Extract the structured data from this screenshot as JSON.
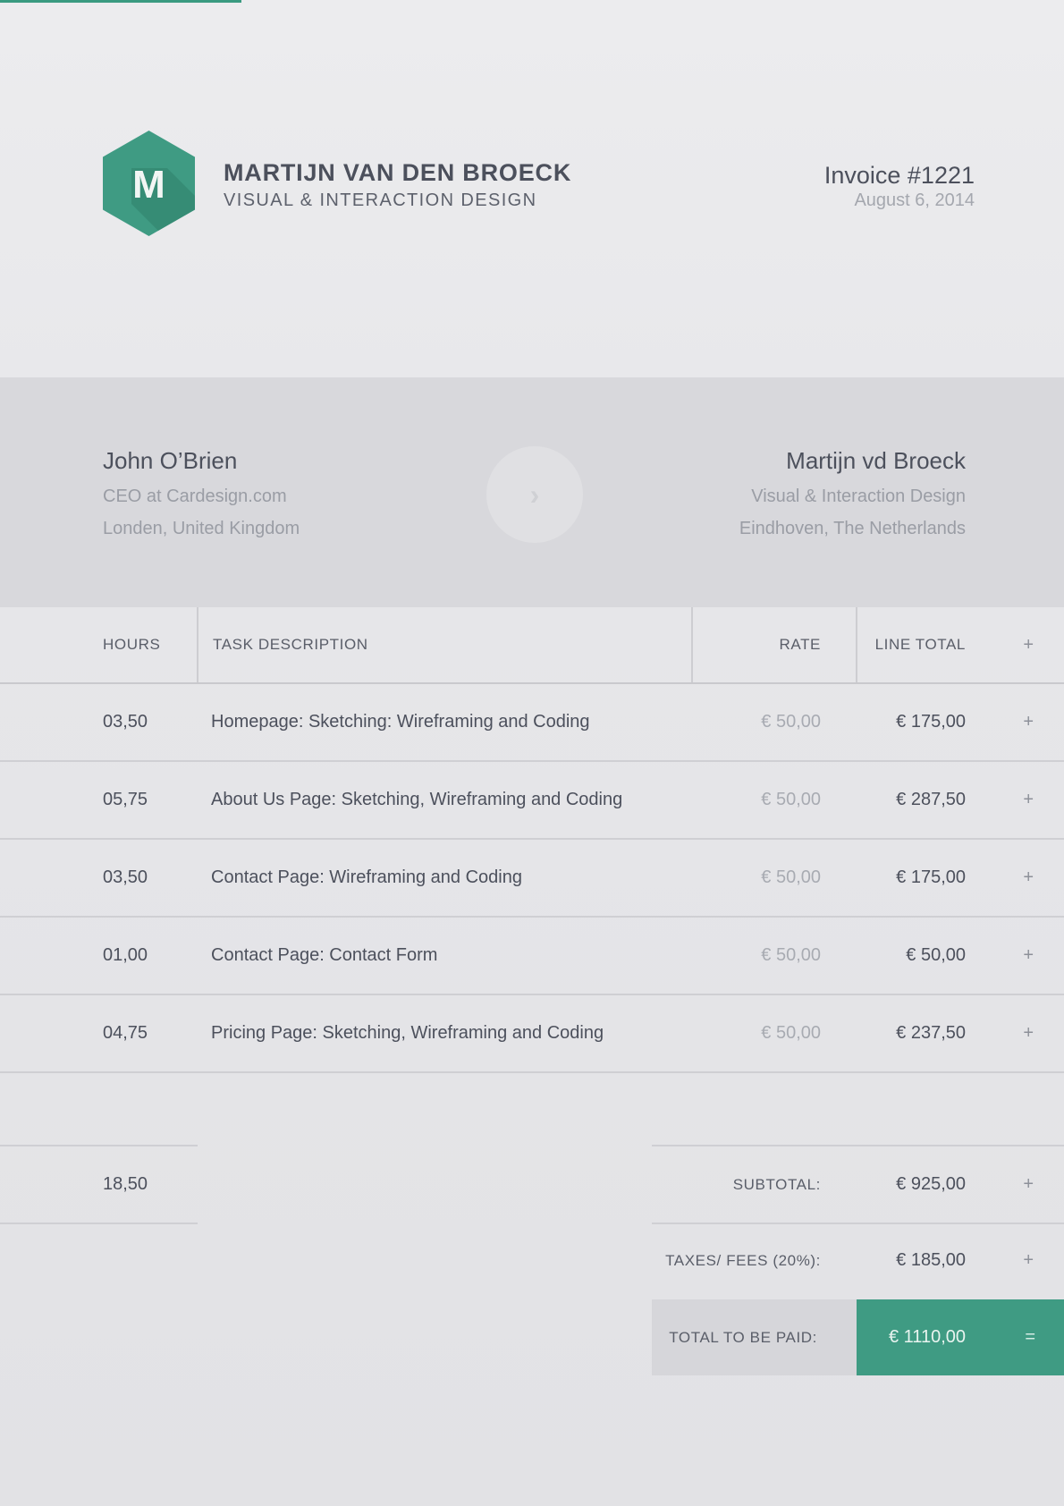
{
  "brand": {
    "logo_letter": "M",
    "name": "MARTIJN VAN DEN BROECK",
    "tagline": "VISUAL & INTERACTION DESIGN",
    "accent_color": "#3f9b83"
  },
  "invoice": {
    "number": "Invoice #1221",
    "date": "August 6, 2014"
  },
  "from_to": {
    "client": {
      "name": "John O’Brien",
      "title": "CEO at Cardesign.com",
      "location": "Londen, United Kingdom"
    },
    "arrow_icon": "chevron-right-icon",
    "sender": {
      "name": "Martijn vd Broeck",
      "title": "Visual & Interaction Design",
      "location": "Eindhoven, The Netherlands"
    }
  },
  "table": {
    "headers": {
      "hours": "HOURS",
      "description": "TASK DESCRIPTION",
      "rate": "RATE",
      "line_total": "LINE TOTAL",
      "add": "+"
    },
    "rows": [
      {
        "hours": "03,50",
        "description": "Homepage: Sketching: Wireframing and Coding",
        "rate": "€ 50,00",
        "total": "€ 175,00",
        "op": "+"
      },
      {
        "hours": "05,75",
        "description": "About Us Page: Sketching, Wireframing and Coding",
        "rate": "€ 50,00",
        "total": "€ 287,50",
        "op": "+"
      },
      {
        "hours": "03,50",
        "description": "Contact Page: Wireframing and Coding",
        "rate": "€ 50,00",
        "total": "€ 175,00",
        "op": "+"
      },
      {
        "hours": "01,00",
        "description": "Contact Page: Contact Form",
        "rate": "€ 50,00",
        "total": "€ 50,00",
        "op": "+"
      },
      {
        "hours": "04,75",
        "description": "Pricing Page: Sketching,  Wireframing and Coding",
        "rate": "€ 50,00",
        "total": "€ 237,50",
        "op": "+"
      }
    ]
  },
  "summary": {
    "total_hours": "18,50",
    "subtotal_label": "SUBTOTAL:",
    "subtotal_value": "€ 925,00",
    "subtotal_op": "+",
    "taxes_label": "TAXES/ FEES (20%):",
    "taxes_value": "€ 185,00",
    "taxes_op": "+",
    "total_label": "TOTAL TO BE PAID:",
    "total_value": "€ 1110,00",
    "total_op": "="
  }
}
